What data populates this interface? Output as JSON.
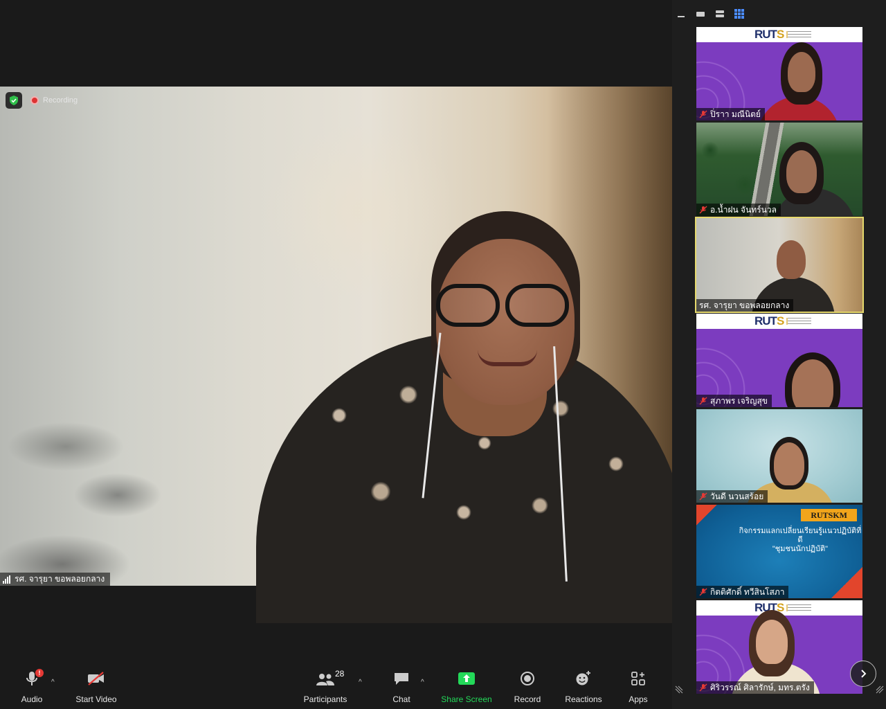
{
  "main_video": {
    "recording_label": "Recording",
    "speaker_name": "รศ. จารุยา ขอพลอยกลาง"
  },
  "gallery": {
    "tiles": [
      {
        "name": "ปิ่ราา มณีนิตย์",
        "muted": true,
        "active": false
      },
      {
        "name": "อ.น้ำฝน จันทร์นวล",
        "muted": true,
        "active": false
      },
      {
        "name": "รศ. จารุยา ขอพลอยกลาง",
        "muted": false,
        "active": true
      },
      {
        "name": "สุภาพร เจริญสุข",
        "muted": true,
        "active": false
      },
      {
        "name": "วันดี นวนสร้อย",
        "muted": true,
        "active": false
      },
      {
        "name": "กิตติศักดิ์ ทวีสินโสภา",
        "muted": true,
        "active": false
      },
      {
        "name": "ศิริวรรณ์ ศิลารักษ์, มทร.ตรัง",
        "muted": true,
        "active": false
      }
    ],
    "ruts_logo": "RUTS",
    "banner": {
      "label": "RUTSKM",
      "line1": "กิจกรรมแลกเปลี่ยนเรียนรู้แนวปฏิบัติที่ดี",
      "line2": "\"ชุมชนนักปฏิบัติ\""
    }
  },
  "toolbar": {
    "audio_label": "Audio",
    "audio_alert": "!",
    "video_label": "Start Video",
    "participants_label": "Participants",
    "participants_count": "28",
    "chat_label": "Chat",
    "share_label": "Share Screen",
    "record_label": "Record",
    "reactions_label": "Reactions",
    "apps_label": "Apps",
    "caret": "^"
  },
  "colors": {
    "share_green": "#23d959",
    "active_border": "#e6d96c",
    "mute_red": "#e53935",
    "ruts_purple": "#7c3cbf"
  }
}
